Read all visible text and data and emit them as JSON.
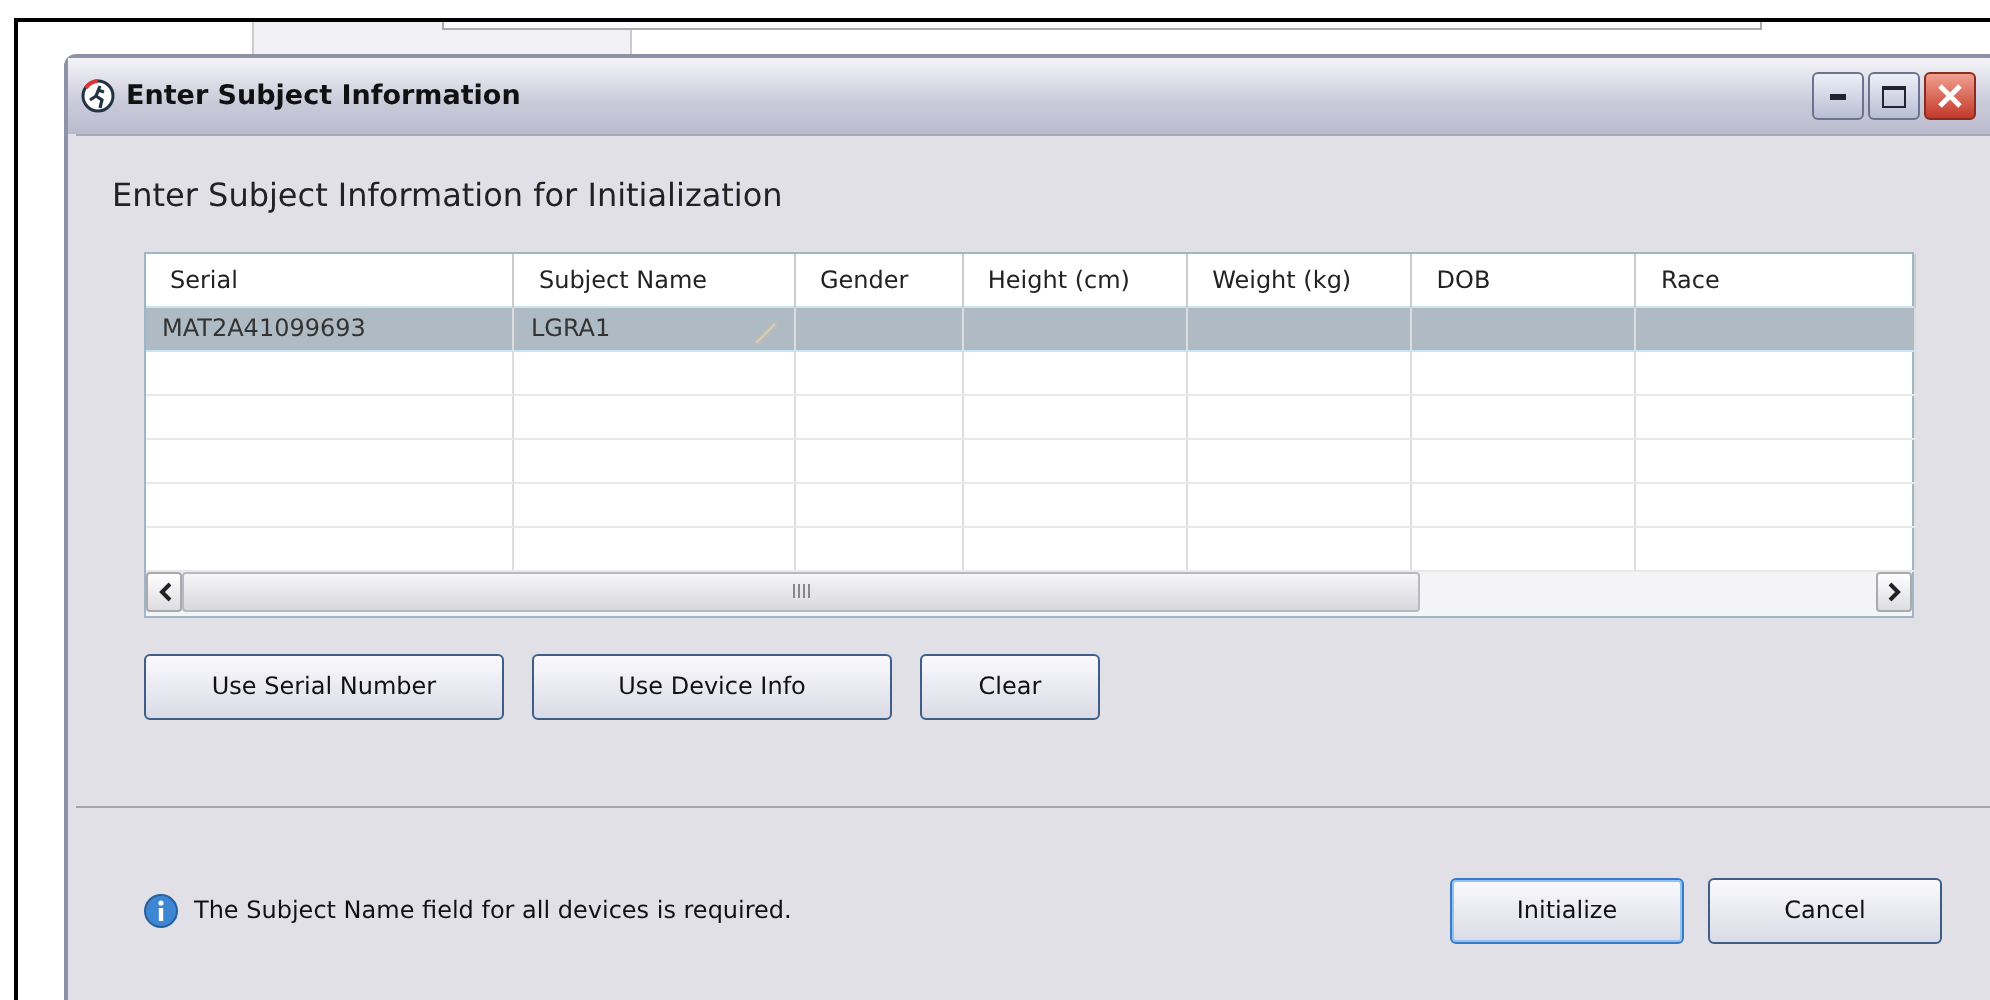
{
  "window": {
    "title": "Enter Subject Information"
  },
  "heading": "Enter Subject Information for Initialization",
  "table": {
    "columns": [
      "Serial",
      "Subject Name",
      "Gender",
      "Height (cm)",
      "Weight (kg)",
      "DOB",
      "Race"
    ],
    "rows": [
      {
        "cells": [
          "MAT2A41099693",
          "LGRA1",
          "",
          "",
          "",
          "",
          ""
        ],
        "selected": true,
        "editing": true
      },
      {
        "cells": [
          "",
          "",
          "",
          "",
          "",
          "",
          ""
        ],
        "selected": false,
        "editing": false
      },
      {
        "cells": [
          "",
          "",
          "",
          "",
          "",
          "",
          ""
        ],
        "selected": false,
        "editing": false
      },
      {
        "cells": [
          "",
          "",
          "",
          "",
          "",
          "",
          ""
        ],
        "selected": false,
        "editing": false
      },
      {
        "cells": [
          "",
          "",
          "",
          "",
          "",
          "",
          ""
        ],
        "selected": false,
        "editing": false
      },
      {
        "cells": [
          "",
          "",
          "",
          "",
          "",
          "",
          ""
        ],
        "selected": false,
        "editing": false
      }
    ]
  },
  "actions": [
    "Use Serial Number",
    "Use Device Info",
    "Clear"
  ],
  "message": "The Subject Name field for all devices is required.",
  "buttons": [
    {
      "label": "Initialize",
      "default": true
    },
    {
      "label": "Cancel",
      "default": false
    }
  ]
}
